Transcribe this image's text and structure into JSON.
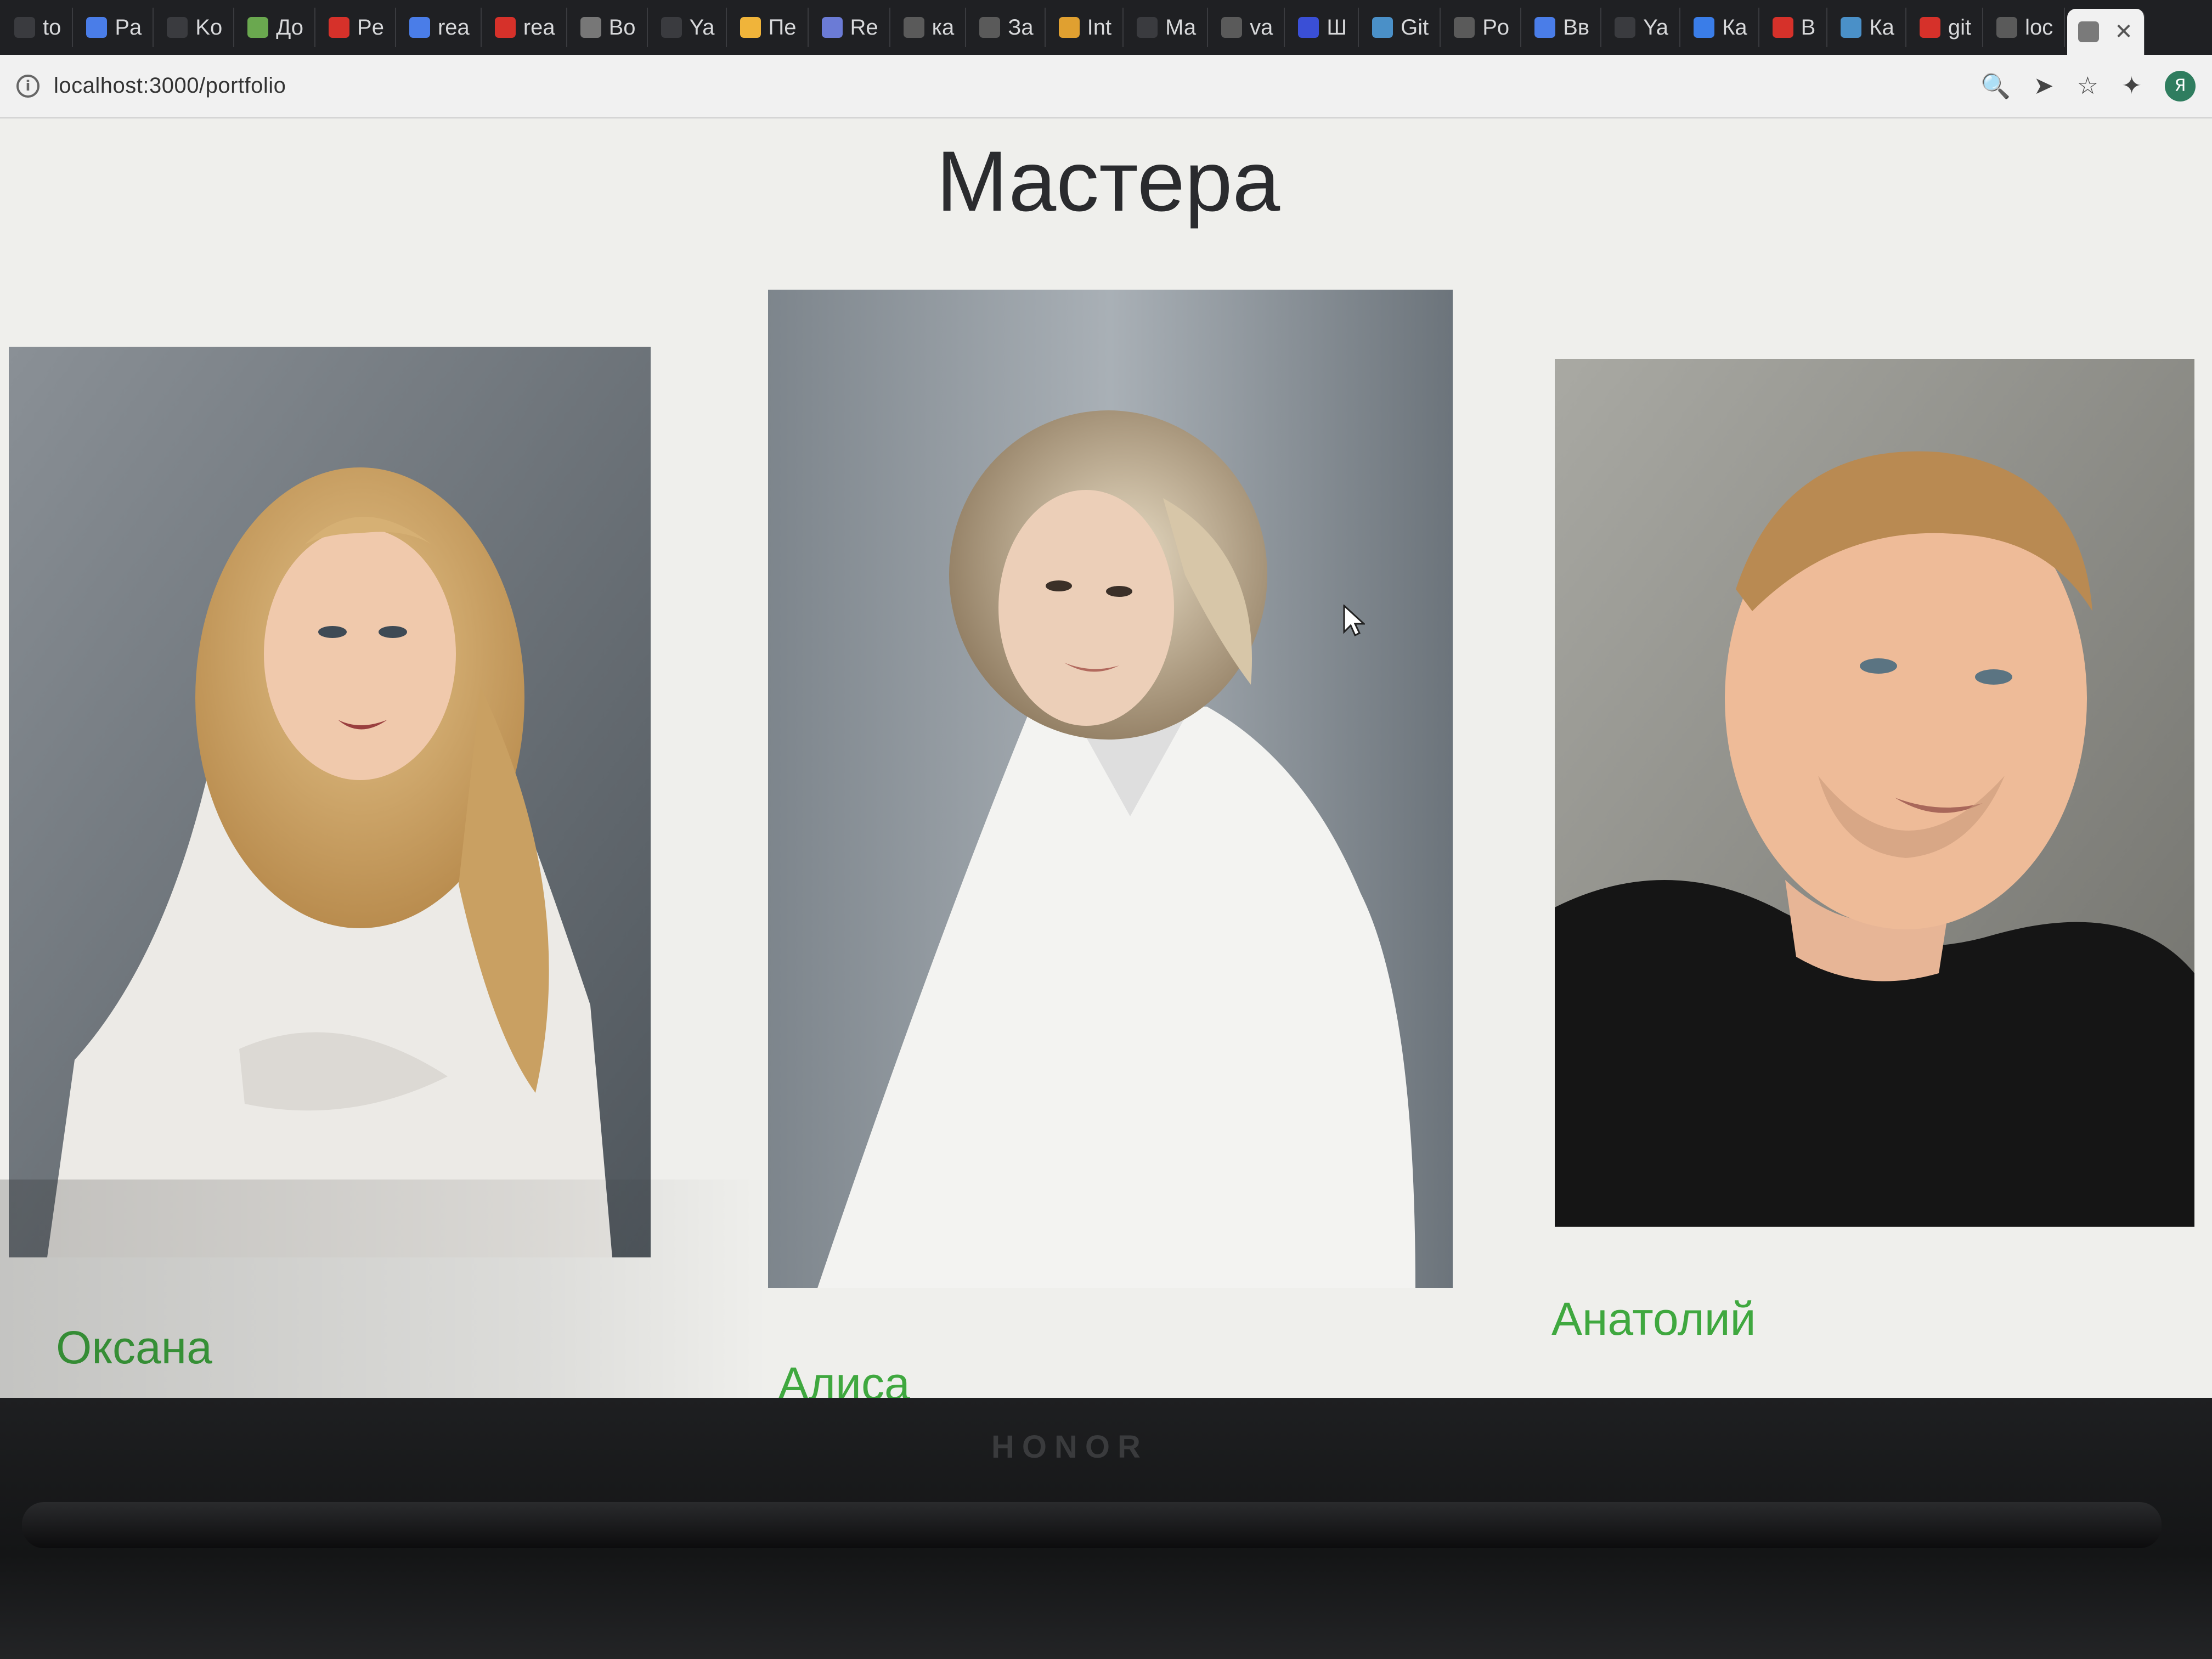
{
  "browser": {
    "tabs": [
      {
        "label": "to",
        "icon": "document-icon",
        "color": "#3a3b3f"
      },
      {
        "label": "Pa",
        "icon": "docs-icon",
        "color": "#4a7de8"
      },
      {
        "label": "Ko",
        "icon": "code-icon",
        "color": "#3a3b3f"
      },
      {
        "label": "До",
        "icon": "android-icon",
        "color": "#6aa84f"
      },
      {
        "label": "Pe",
        "icon": "hh-icon",
        "color": "#d6312a"
      },
      {
        "label": "rea",
        "icon": "app-icon",
        "color": "#4a7de8"
      },
      {
        "label": "rea",
        "icon": "app-icon",
        "color": "#d6312a"
      },
      {
        "label": "Bo",
        "icon": "app-icon",
        "color": "#777777"
      },
      {
        "label": "Ya",
        "icon": "yandex-icon",
        "color": "#3a3b3f"
      },
      {
        "label": "Пе",
        "icon": "note-icon",
        "color": "#f0b43a"
      },
      {
        "label": "Re",
        "icon": "github-icon",
        "color": "#6b7bd6"
      },
      {
        "label": "ка",
        "icon": "google-icon",
        "color": "#5a5a5a"
      },
      {
        "label": "За",
        "icon": "globe-icon",
        "color": "#5a5a5a"
      },
      {
        "label": "Int",
        "icon": "bolt-icon",
        "color": "#e0a030"
      },
      {
        "label": "Ма",
        "icon": "app-icon",
        "color": "#3a3b3f"
      },
      {
        "label": "va",
        "icon": "google-icon",
        "color": "#5a5a5a"
      },
      {
        "label": "Ш",
        "icon": "app-icon",
        "color": "#3a4fd6"
      },
      {
        "label": "Git",
        "icon": "app-icon",
        "color": "#4a90c8"
      },
      {
        "label": "Po",
        "icon": "wikipedia-icon",
        "color": "#5a5a5a"
      },
      {
        "label": "Вв",
        "icon": "code-icon",
        "color": "#4a7de8"
      },
      {
        "label": "Ya",
        "icon": "yandex-icon",
        "color": "#3a3b3f"
      },
      {
        "label": "Ка",
        "icon": "vk-icon",
        "color": "#3a7de8"
      },
      {
        "label": "В",
        "icon": "app-icon",
        "color": "#d6312a"
      },
      {
        "label": "Ка",
        "icon": "app-icon",
        "color": "#4a90c8"
      },
      {
        "label": "git",
        "icon": "question-icon",
        "color": "#d6312a"
      },
      {
        "label": "loc",
        "icon": "globe-icon",
        "color": "#5a5a5a"
      }
    ],
    "active_tab_icon": "globe-icon",
    "url": "localhost:3000/portfolio",
    "toolbar": {
      "zoom_icon": "🔍",
      "send_icon": "➤",
      "star_icon": "☆",
      "extensions_icon": "✦",
      "profile_initial": "Я"
    }
  },
  "page": {
    "title": "Мастера",
    "masters": [
      {
        "name": "Оксана",
        "photo": "portrait-woman-blonde",
        "accent": "#3fa83f"
      },
      {
        "name": "Алиса",
        "photo": "portrait-woman-short-hair",
        "accent": "#3fa83f"
      },
      {
        "name": "Анатолий",
        "photo": "portrait-man",
        "accent": "#3fa83f"
      }
    ]
  },
  "laptop": {
    "brand": "HONOR"
  }
}
